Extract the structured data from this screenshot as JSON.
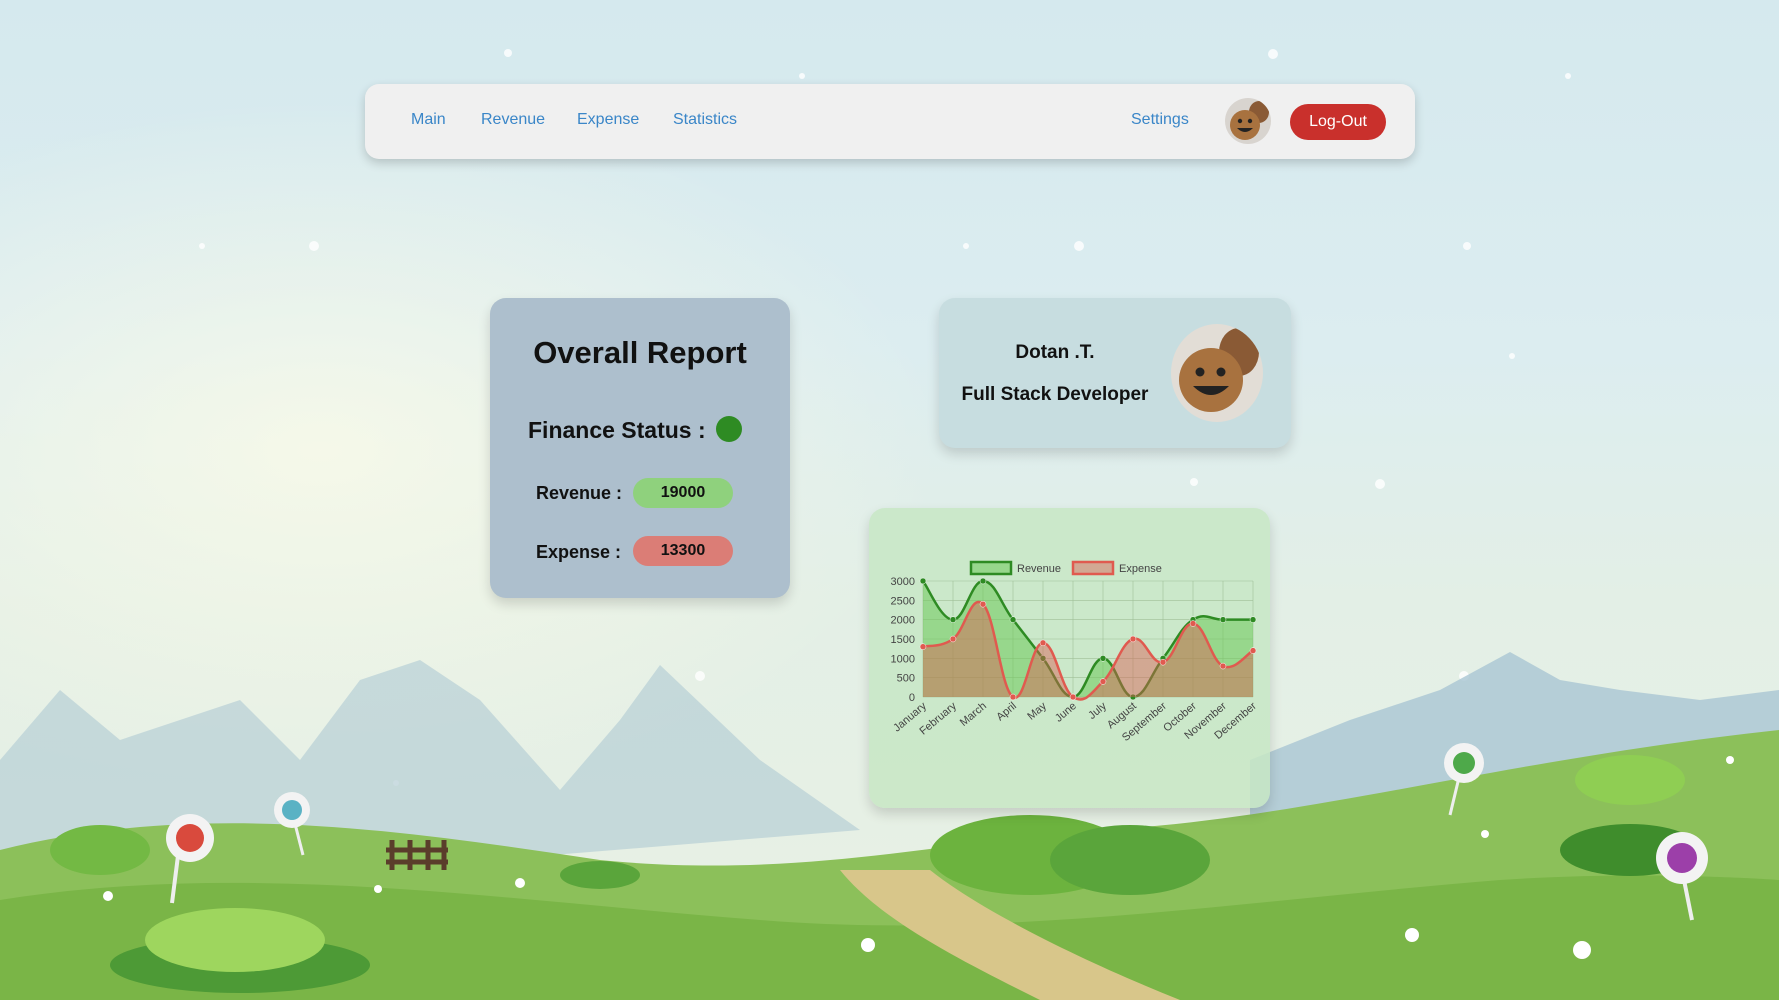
{
  "nav": {
    "links": [
      "Main",
      "Revenue",
      "Expense",
      "Statistics"
    ],
    "settings_label": "Settings",
    "logout_label": "Log-Out",
    "avatar_icon": "avatar-face-icon"
  },
  "report": {
    "title": "Overall Report",
    "finance_status_label": "Finance Status :",
    "finance_status_color": "#2e8b23",
    "revenue_label": "Revenue :",
    "revenue_value": "19000",
    "expense_label": "Expense :",
    "expense_value": "13300",
    "colors": {
      "revenue_pill": "#8fd17d",
      "expense_pill": "#db7d76"
    }
  },
  "profile": {
    "name": "Dotan .T.",
    "role": "Full Stack Developer"
  },
  "chart_data": {
    "type": "area",
    "categories": [
      "January",
      "February",
      "March",
      "April",
      "May",
      "June",
      "July",
      "August",
      "September",
      "October",
      "November",
      "December"
    ],
    "series": [
      {
        "name": "Revenue",
        "values": [
          3000,
          2000,
          3000,
          2000,
          1000,
          0,
          1000,
          0,
          1000,
          2000,
          2000,
          2000
        ],
        "color": "#2e8b23",
        "fill": "rgba(110, 200, 90, 0.55)"
      },
      {
        "name": "Expense",
        "values": [
          1300,
          1500,
          2400,
          0,
          1400,
          0,
          400,
          1500,
          900,
          1900,
          800,
          1200
        ],
        "color": "#e05a4f",
        "fill": "rgba(220, 90, 80, 0.45)"
      }
    ],
    "yticks": [
      0,
      500,
      1000,
      1500,
      2000,
      2500,
      3000
    ],
    "ylim": [
      0,
      3000
    ],
    "grid": true,
    "legend_position": "top"
  }
}
